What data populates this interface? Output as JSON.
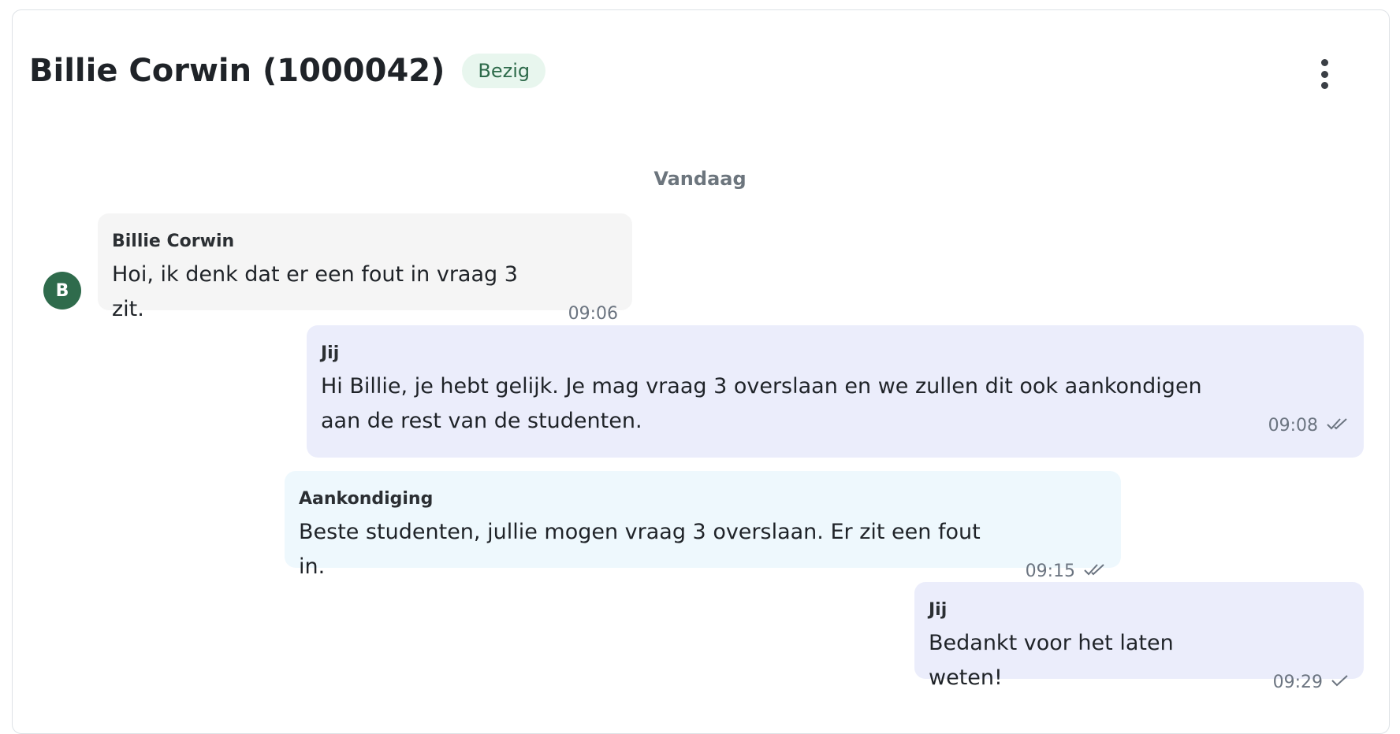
{
  "header": {
    "title": "Billie Corwin (1000042)",
    "status": "Bezig"
  },
  "date_divider": "Vandaag",
  "avatar": {
    "initial": "B"
  },
  "messages": [
    {
      "sender": "Billie Corwin",
      "text": "Hoi, ik denk dat er een fout in vraag 3 zit.",
      "time": "09:06",
      "tick": ""
    },
    {
      "sender": "Jij",
      "text": "Hi Billie, je hebt gelijk. Je mag vraag 3 overslaan en we zullen dit ook aankondigen aan de rest van de studenten.",
      "time": "09:08",
      "tick": "double-check-icon"
    },
    {
      "sender": "Aankondiging",
      "text": "Beste studenten, jullie mogen vraag 3 overslaan. Er zit een fout in.",
      "time": "09:15",
      "tick": "double-check-icon"
    },
    {
      "sender": "Jij",
      "text": "Bedankt voor het laten weten!",
      "time": "09:29",
      "tick": "check-icon"
    }
  ],
  "colors": {
    "avatar_bg": "#2f6b4c",
    "badge_bg": "#e8f6ee",
    "badge_text": "#2d6a4a",
    "incoming_bubble": "#f5f5f5",
    "outgoing_bubble": "#ebedfb",
    "announcement_bubble": "#eef8fd"
  }
}
